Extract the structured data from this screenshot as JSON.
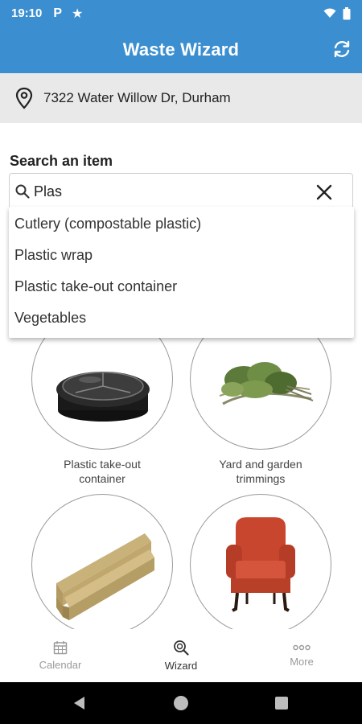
{
  "status_bar": {
    "time": "19:10",
    "p_icon": "P",
    "star_icon": "★",
    "icons_right": [
      "wifi-icon",
      "battery-icon"
    ]
  },
  "app_bar": {
    "title": "Waste Wizard",
    "refresh_icon": "refresh-icon"
  },
  "address": {
    "text": "7322 Water Willow Dr, Durham",
    "icon": "location-pin-icon"
  },
  "search": {
    "label": "Search an item",
    "value": "Plas",
    "icon": "search-icon",
    "clear_icon": "close-icon"
  },
  "suggestions": [
    "Cutlery (compostable plastic)",
    "Plastic wrap",
    "Plastic take-out container",
    "Vegetables"
  ],
  "tiles": [
    {
      "label_line1": "Plastic take-out",
      "label_line2": "container"
    },
    {
      "label_line1": "Yard and garden",
      "label_line2": "trimmings"
    },
    {
      "label_line1": "",
      "label_line2": ""
    },
    {
      "label_line1": "",
      "label_line2": ""
    }
  ],
  "bottom_nav": [
    {
      "label": "Calendar",
      "icon": "calendar-icon",
      "active": false
    },
    {
      "label": "Wizard",
      "icon": "wizard-search-icon",
      "active": true
    },
    {
      "label": "More",
      "icon": "more-icon",
      "active": false
    }
  ],
  "colors": {
    "primary": "#3b8fd0",
    "address_bg": "#e9e9e9"
  }
}
